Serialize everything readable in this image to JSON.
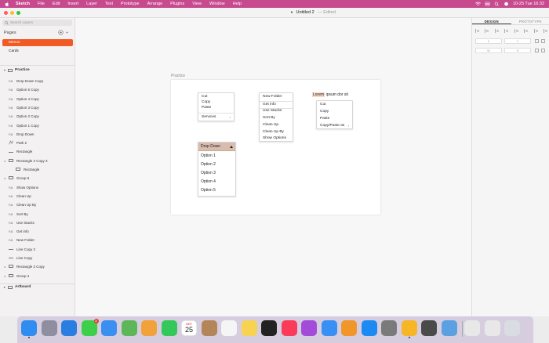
{
  "menubar": {
    "app_name": "Sketch",
    "menus": [
      "File",
      "Edit",
      "Insert",
      "Layer",
      "Text",
      "Prototype",
      "Arrange",
      "Plugins",
      "View",
      "Window",
      "Help"
    ],
    "datetime": "10-25 Tue 16:32"
  },
  "window": {
    "doc_title": "Untitled 2",
    "doc_status": "— Edited"
  },
  "sidebar": {
    "search_placeholder": "Search Layers",
    "pages_label": "Pages",
    "pages": [
      {
        "label": "Menus",
        "active": true
      },
      {
        "label": "Cards",
        "active": false
      }
    ],
    "artboard_section": "Practice",
    "layers": [
      {
        "label": "Drop Down Copy",
        "icon": "text-icon",
        "expandable": false,
        "indent": 0
      },
      {
        "label": "Option 5 Copy",
        "icon": "text-icon",
        "expandable": false,
        "indent": 0
      },
      {
        "label": "Option 4 Copy",
        "icon": "text-icon",
        "expandable": false,
        "indent": 0
      },
      {
        "label": "Option 3 Copy",
        "icon": "text-icon",
        "expandable": false,
        "indent": 0
      },
      {
        "label": "Option 2 Copy",
        "icon": "text-icon",
        "expandable": false,
        "indent": 0
      },
      {
        "label": "Option 1 Copy",
        "icon": "text-icon",
        "expandable": false,
        "indent": 0
      },
      {
        "label": "Drop Down",
        "icon": "text-icon",
        "expandable": false,
        "indent": 0
      },
      {
        "label": "Path 2",
        "icon": "path-icon",
        "expandable": false,
        "indent": 0
      },
      {
        "label": "Rectangle",
        "icon": "line-icon",
        "expandable": false,
        "indent": 0
      },
      {
        "label": "Rectangle 2 Copy 3",
        "icon": "folder-icon",
        "expandable": true,
        "indent": 0
      },
      {
        "label": "Rectangle",
        "icon": "rectangle-icon",
        "expandable": false,
        "indent": 1
      },
      {
        "label": "Group 6",
        "icon": "folder-icon",
        "expandable": true,
        "indent": 0
      },
      {
        "label": "Show Options",
        "icon": "text-icon",
        "expandable": false,
        "indent": 0
      },
      {
        "label": "Clean Up",
        "icon": "text-icon",
        "expandable": false,
        "indent": 0
      },
      {
        "label": "Clean Up By",
        "icon": "text-icon",
        "expandable": false,
        "indent": 0
      },
      {
        "label": "Sort By",
        "icon": "text-icon",
        "expandable": false,
        "indent": 0
      },
      {
        "label": "Use Stacks",
        "icon": "text-icon",
        "expandable": false,
        "indent": 0
      },
      {
        "label": "Get info",
        "icon": "text-icon",
        "expandable": false,
        "indent": 0
      },
      {
        "label": "New Folder",
        "icon": "text-icon",
        "expandable": false,
        "indent": 0
      },
      {
        "label": "Line Copy 2",
        "icon": "line-icon",
        "expandable": false,
        "indent": 0
      },
      {
        "label": "Line Copy",
        "icon": "line-icon",
        "expandable": false,
        "indent": 0
      },
      {
        "label": "Rectangle 2 Copy",
        "icon": "folder-icon",
        "expandable": true,
        "indent": 0
      },
      {
        "label": "Group 4",
        "icon": "folder-icon",
        "expandable": true,
        "indent": 0
      }
    ],
    "artboard_section_2": "Artboard"
  },
  "canvas": {
    "artboard_label": "Practice",
    "edit_menu": {
      "items": [
        "Cut",
        "Copy",
        "Paste"
      ],
      "services": "Services",
      "services_arrow": "›"
    },
    "finder_menu": {
      "items": [
        "New Folder",
        "Get info",
        "Use Stacks",
        "Sort By",
        "Clean Up",
        "Clean Up By",
        "Show Options"
      ]
    },
    "text_menu": {
      "lorem_highlight": "Lorem",
      "lorem_rest": " ipsum dor sit",
      "items": [
        "Cut",
        "Copy",
        "Paste"
      ],
      "copy_paste_as": "Copy/Paste as",
      "arrow": "›"
    },
    "dropdown": {
      "header": "Drop Down",
      "options": [
        "Option 1",
        "Option 2",
        "Option 3",
        "Option 4",
        "Option 5"
      ]
    }
  },
  "inspector": {
    "tabs": [
      "DESIGN",
      "PROTOTYPE"
    ],
    "active_tab": "DESIGN",
    "fields": {
      "x": "X",
      "y": "Y",
      "w": "W",
      "h": "H"
    }
  },
  "dock": {
    "apps": [
      {
        "name": "finder-icon",
        "color": "#2f8cf0"
      },
      {
        "name": "launchpad-icon",
        "color": "#8e8ea0"
      },
      {
        "name": "safari-icon",
        "color": "#2a7de1"
      },
      {
        "name": "messages-icon",
        "color": "#3ecf4a",
        "badge": "2"
      },
      {
        "name": "mail-icon",
        "color": "#3b8ff0"
      },
      {
        "name": "maps-icon",
        "color": "#5db75a"
      },
      {
        "name": "photos-icon",
        "color": "#f2a23a"
      },
      {
        "name": "facetime-icon",
        "color": "#34c759"
      },
      {
        "name": "calendar-icon",
        "color": "#ffffff",
        "text": "25",
        "month": "OCT"
      },
      {
        "name": "contacts-icon",
        "color": "#b3865a"
      },
      {
        "name": "reminders-icon",
        "color": "#f5f5f5"
      },
      {
        "name": "notes-icon",
        "color": "#f7d351"
      },
      {
        "name": "tv-icon",
        "color": "#222222"
      },
      {
        "name": "music-icon",
        "color": "#fa3c5a"
      },
      {
        "name": "podcasts-icon",
        "color": "#a24cd9"
      },
      {
        "name": "keynote-icon",
        "color": "#3a8ff5"
      },
      {
        "name": "pages-icon",
        "color": "#f0962a"
      },
      {
        "name": "app-store-icon",
        "color": "#1d8af3"
      },
      {
        "name": "system-preferences-icon",
        "color": "#7a7a7a"
      },
      {
        "name": "sketch-icon",
        "color": "#f7b626"
      },
      {
        "name": "quicktime-icon",
        "color": "#4a4a4a"
      },
      {
        "name": "preview-icon",
        "color": "#5ba0e0"
      },
      {
        "name": "downloads-stack-icon",
        "color": "#e8e8e8"
      },
      {
        "name": "screenshots-stack-icon",
        "color": "#e8e8e8"
      },
      {
        "name": "trash-icon",
        "color": "#d9dde3"
      }
    ]
  }
}
